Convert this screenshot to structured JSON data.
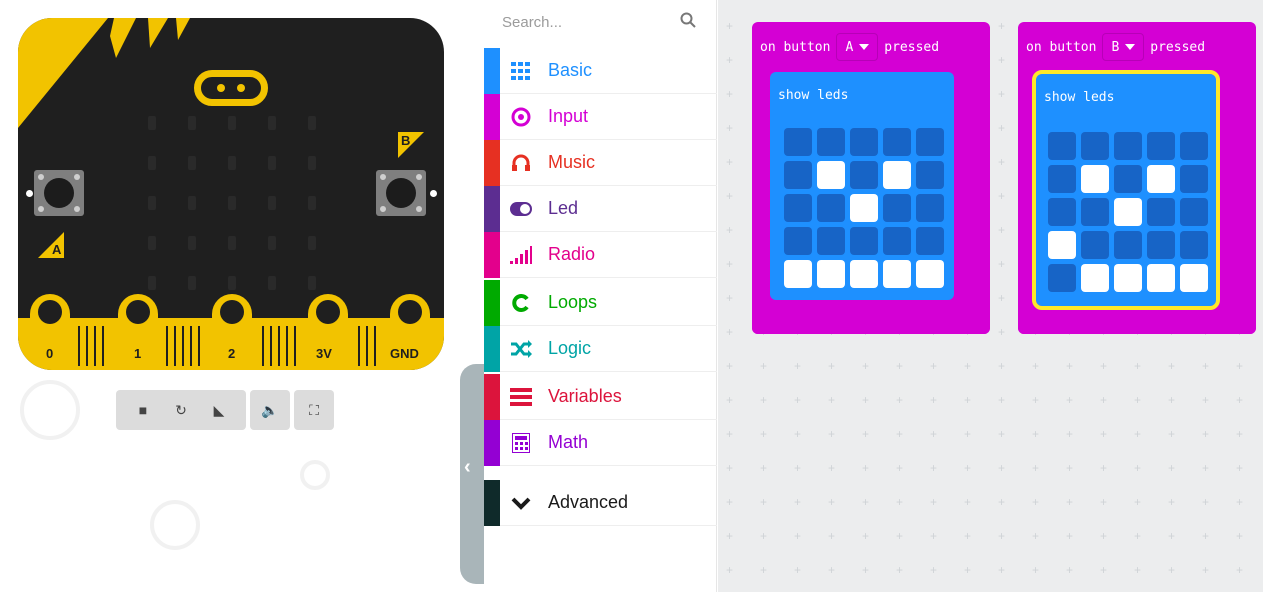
{
  "simulator": {
    "board_label_a": "A",
    "board_label_b": "B",
    "pins": [
      "0",
      "1",
      "2",
      "3V",
      "GND"
    ],
    "controls": [
      {
        "name": "stop",
        "icon": "stop-icon",
        "glyph": "■"
      },
      {
        "name": "restart",
        "icon": "restart-icon",
        "glyph": "↻"
      },
      {
        "name": "slow-mo",
        "icon": "snail-icon",
        "glyph": "◣"
      },
      {
        "name": "mute",
        "icon": "speaker-icon",
        "glyph": "🔈"
      },
      {
        "name": "fullscreen",
        "icon": "fullscreen-icon",
        "glyph": "⛶"
      }
    ],
    "accent": "#f2c300",
    "board_color": "#1f1f1f"
  },
  "collapse": {
    "glyph": "‹"
  },
  "toolbox": {
    "search": {
      "placeholder": "Search..."
    },
    "categories": [
      {
        "label": "Basic",
        "color": "#1e90ff",
        "icon": "grid-icon"
      },
      {
        "label": "Input",
        "color": "#d400d4",
        "icon": "target-icon"
      },
      {
        "label": "Music",
        "color": "#e63022",
        "icon": "headphones-icon"
      },
      {
        "label": "Led",
        "color": "#5c2d91",
        "icon": "toggle-icon"
      },
      {
        "label": "Radio",
        "color": "#e3008c",
        "icon": "signal-icon"
      },
      {
        "label": "Loops",
        "color": "#00aa00",
        "icon": "loop-icon"
      },
      {
        "label": "Logic",
        "color": "#00a4a6",
        "icon": "shuffle-icon"
      },
      {
        "label": "Variables",
        "color": "#dc143c",
        "icon": "lines-icon"
      },
      {
        "label": "Math",
        "color": "#9400d3",
        "icon": "calculator-icon"
      },
      {
        "label": "Advanced",
        "color": "#3c3c3c",
        "icon": "chevron-down-icon"
      }
    ]
  },
  "workspace": {
    "blocks": [
      {
        "event_prefix": "on button",
        "button": "A",
        "event_suffix": "pressed",
        "inner_label": "show leds",
        "selected": false,
        "leds": [
          [
            0,
            0,
            0,
            0,
            0
          ],
          [
            0,
            1,
            0,
            1,
            0
          ],
          [
            0,
            0,
            1,
            0,
            0
          ],
          [
            0,
            0,
            0,
            0,
            0
          ],
          [
            1,
            1,
            1,
            1,
            1
          ]
        ]
      },
      {
        "event_prefix": "on button",
        "button": "B",
        "event_suffix": "pressed",
        "inner_label": "show leds",
        "selected": true,
        "leds": [
          [
            0,
            0,
            0,
            0,
            0
          ],
          [
            0,
            1,
            0,
            1,
            0
          ],
          [
            0,
            0,
            1,
            0,
            0
          ],
          [
            1,
            0,
            0,
            0,
            0
          ],
          [
            0,
            1,
            1,
            1,
            1
          ]
        ]
      }
    ],
    "event_color": "#d400d4",
    "basic_color": "#1e90ff"
  }
}
